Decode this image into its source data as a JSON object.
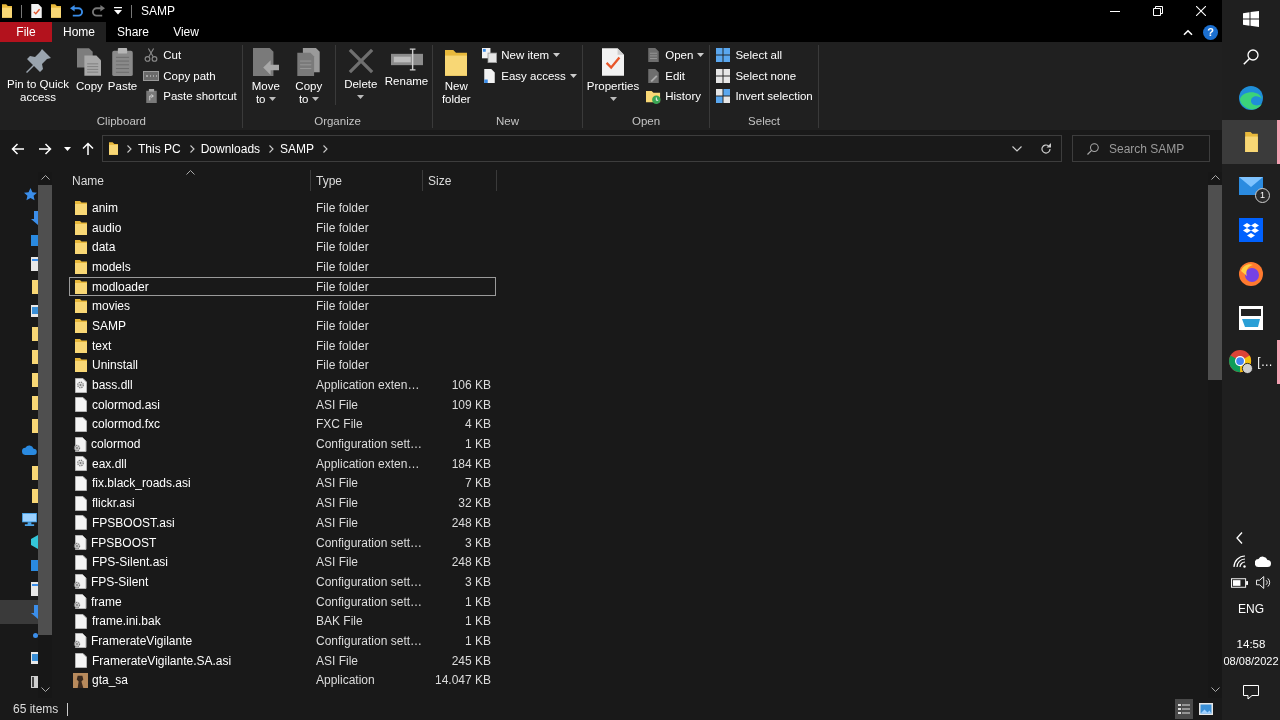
{
  "window": {
    "title": "SAMP"
  },
  "ribbon": {
    "tabs": [
      {
        "label": "File",
        "kind": "file",
        "selected": false
      },
      {
        "label": "Home",
        "kind": "tab",
        "selected": true
      },
      {
        "label": "Share",
        "kind": "tab",
        "selected": false
      },
      {
        "label": "View",
        "kind": "tab",
        "selected": false
      }
    ],
    "help": "?",
    "groups": [
      {
        "label": "Clipboard",
        "large_buttons": [
          {
            "kind": "pin",
            "label": "Pin to Quick access",
            "dropdown": false,
            "separator_before": false
          },
          {
            "kind": "copy",
            "label": "Copy",
            "dropdown": false,
            "separator_before": false
          },
          {
            "kind": "paste",
            "label": "Paste",
            "dropdown": false,
            "separator_before": false
          }
        ],
        "small_buttons": [
          {
            "kind": "cut",
            "label": "Cut",
            "dropdown": false
          },
          {
            "kind": "copy-path",
            "label": "Copy path",
            "dropdown": false
          },
          {
            "kind": "paste-shortcut",
            "label": "Paste shortcut",
            "dropdown": false
          }
        ]
      },
      {
        "label": "Organize",
        "large_buttons": [
          {
            "kind": "move-to",
            "label": "Move to",
            "dropdown": true,
            "separator_before": false
          },
          {
            "kind": "copy-to",
            "label": "Copy to",
            "dropdown": true,
            "separator_before": false
          },
          {
            "kind": "delete",
            "label": "Delete",
            "dropdown": true,
            "separator_before": true
          },
          {
            "kind": "rename",
            "label": "Rename",
            "dropdown": false,
            "separator_before": false
          }
        ]
      },
      {
        "label": "New",
        "large_buttons": [
          {
            "kind": "new-folder",
            "label": "New folder",
            "dropdown": false,
            "separator_before": false
          }
        ],
        "small_buttons": [
          {
            "kind": "new-item",
            "label": "New item",
            "dropdown": true
          },
          {
            "kind": "easy-access",
            "label": "Easy access",
            "dropdown": true
          }
        ]
      },
      {
        "label": "Open",
        "large_buttons": [
          {
            "kind": "properties",
            "label": "Properties",
            "dropdown": true,
            "separator_before": false
          }
        ],
        "small_buttons": [
          {
            "kind": "open",
            "label": "Open",
            "dropdown": true
          },
          {
            "kind": "edit",
            "label": "Edit",
            "dropdown": false
          },
          {
            "kind": "history",
            "label": "History",
            "dropdown": false
          }
        ]
      },
      {
        "label": "Select",
        "small_buttons": [
          {
            "kind": "select-all",
            "label": "Select all",
            "dropdown": false
          },
          {
            "kind": "select-none",
            "label": "Select none",
            "dropdown": false
          },
          {
            "kind": "invert-selection",
            "label": "Invert selection",
            "dropdown": false
          }
        ]
      }
    ]
  },
  "address_bar": {
    "path": [
      "This PC",
      "Downloads",
      "SAMP"
    ],
    "search": {
      "placeholder": "Search SAMP"
    }
  },
  "nav_pane": {
    "tree": [
      {
        "kind": "star",
        "selected": false,
        "children": [
          {
            "kind": "download",
            "selected": false
          },
          {
            "kind": "desktop",
            "selected": false
          },
          {
            "kind": "document",
            "selected": false
          },
          {
            "kind": "folder",
            "selected": false
          },
          {
            "kind": "picture",
            "selected": false
          },
          {
            "kind": "folder",
            "selected": false
          },
          {
            "kind": "folder",
            "selected": false
          },
          {
            "kind": "folder",
            "selected": false
          },
          {
            "kind": "folder",
            "selected": false
          },
          {
            "kind": "folder",
            "selected": false
          }
        ]
      },
      {
        "kind": "cloud",
        "selected": false,
        "children": [
          {
            "kind": "folder",
            "selected": false
          },
          {
            "kind": "folder",
            "selected": false
          }
        ]
      },
      {
        "kind": "monitor",
        "selected": false,
        "children": [
          {
            "kind": "cube",
            "selected": false
          },
          {
            "kind": "desktop",
            "selected": false
          },
          {
            "kind": "document",
            "selected": false
          },
          {
            "kind": "download",
            "selected": true
          },
          {
            "kind": "music",
            "selected": false
          },
          {
            "kind": "picture",
            "selected": false
          },
          {
            "kind": "video",
            "selected": false
          }
        ]
      }
    ]
  },
  "file_list": {
    "columns": [
      {
        "label": "Name",
        "sorted": true
      },
      {
        "label": "Type",
        "sorted": false
      },
      {
        "label": "Size",
        "sorted": false
      }
    ],
    "rows": [
      {
        "kind": "folder",
        "name": "anim",
        "type": "File folder",
        "focused": false
      },
      {
        "kind": "folder",
        "name": "audio",
        "type": "File folder",
        "focused": false
      },
      {
        "kind": "folder",
        "name": "data",
        "type": "File folder",
        "focused": false
      },
      {
        "kind": "folder",
        "name": "models",
        "type": "File folder",
        "focused": false
      },
      {
        "kind": "folder",
        "name": "modloader",
        "type": "File folder",
        "focused": true
      },
      {
        "kind": "folder",
        "name": "movies",
        "type": "File folder",
        "focused": false
      },
      {
        "kind": "folder",
        "name": "SAMP",
        "type": "File folder",
        "focused": false
      },
      {
        "kind": "folder",
        "name": "text",
        "type": "File folder",
        "focused": false
      },
      {
        "kind": "folder",
        "name": "Uninstall",
        "type": "File folder",
        "focused": false
      },
      {
        "kind": "dll",
        "name": "bass.dll",
        "type": "Application exten…",
        "size": "106 KB",
        "focused": false
      },
      {
        "kind": "file",
        "name": "colormod.asi",
        "type": "ASI File",
        "size": "109 KB",
        "focused": false
      },
      {
        "kind": "file",
        "name": "colormod.fxc",
        "type": "FXC File",
        "size": "4 KB",
        "focused": false
      },
      {
        "kind": "config",
        "name": "colormod",
        "type": "Configuration sett…",
        "size": "1 KB",
        "focused": false
      },
      {
        "kind": "dll",
        "name": "eax.dll",
        "type": "Application exten…",
        "size": "184 KB",
        "focused": false
      },
      {
        "kind": "file",
        "name": "fix.black_roads.asi",
        "type": "ASI File",
        "size": "7 KB",
        "focused": false
      },
      {
        "kind": "file",
        "name": "flickr.asi",
        "type": "ASI File",
        "size": "32 KB",
        "focused": false
      },
      {
        "kind": "file",
        "name": "FPSBOOST.asi",
        "type": "ASI File",
        "size": "248 KB",
        "focused": false
      },
      {
        "kind": "config",
        "name": "FPSBOOST",
        "type": "Configuration sett…",
        "size": "3 KB",
        "focused": false
      },
      {
        "kind": "file",
        "name": "FPS-Silent.asi",
        "type": "ASI File",
        "size": "248 KB",
        "focused": false
      },
      {
        "kind": "config",
        "name": "FPS-Silent",
        "type": "Configuration sett…",
        "size": "3 KB",
        "focused": false
      },
      {
        "kind": "config",
        "name": "frame",
        "type": "Configuration sett…",
        "size": "1 KB",
        "focused": false
      },
      {
        "kind": "file",
        "name": "frame.ini.bak",
        "type": "BAK File",
        "size": "1 KB",
        "focused": false
      },
      {
        "kind": "config",
        "name": "FramerateVigilante",
        "type": "Configuration sett…",
        "size": "1 KB",
        "focused": false
      },
      {
        "kind": "file",
        "name": "FramerateVigilante.SA.asi",
        "type": "ASI File",
        "size": "245 KB",
        "focused": false
      },
      {
        "kind": "app",
        "name": "gta_sa",
        "type": "Application",
        "size": "14.047 KB",
        "focused": false
      }
    ]
  },
  "status_bar": {
    "item_count": "65 items",
    "views": [
      {
        "kind": "details",
        "selected": true
      },
      {
        "kind": "large-icons",
        "selected": false
      }
    ]
  },
  "taskbar": {
    "apps": [
      {
        "kind": "start",
        "selected": false,
        "open": false
      },
      {
        "kind": "search",
        "selected": false,
        "open": false
      },
      {
        "kind": "edge",
        "selected": false,
        "open": false
      },
      {
        "kind": "explorer",
        "selected": true,
        "open": true
      },
      {
        "kind": "mail",
        "selected": false,
        "open": false,
        "badge": "1"
      },
      {
        "kind": "dropbox",
        "selected": false,
        "open": false
      },
      {
        "kind": "firefox",
        "selected": false,
        "open": false
      },
      {
        "kind": "amazon",
        "selected": false,
        "open": false
      },
      {
        "kind": "chrome",
        "selected": false,
        "open": true,
        "label": "[…"
      }
    ],
    "tray": {
      "language": "ENG",
      "time": "14:58",
      "date": "08/08/2022"
    }
  }
}
